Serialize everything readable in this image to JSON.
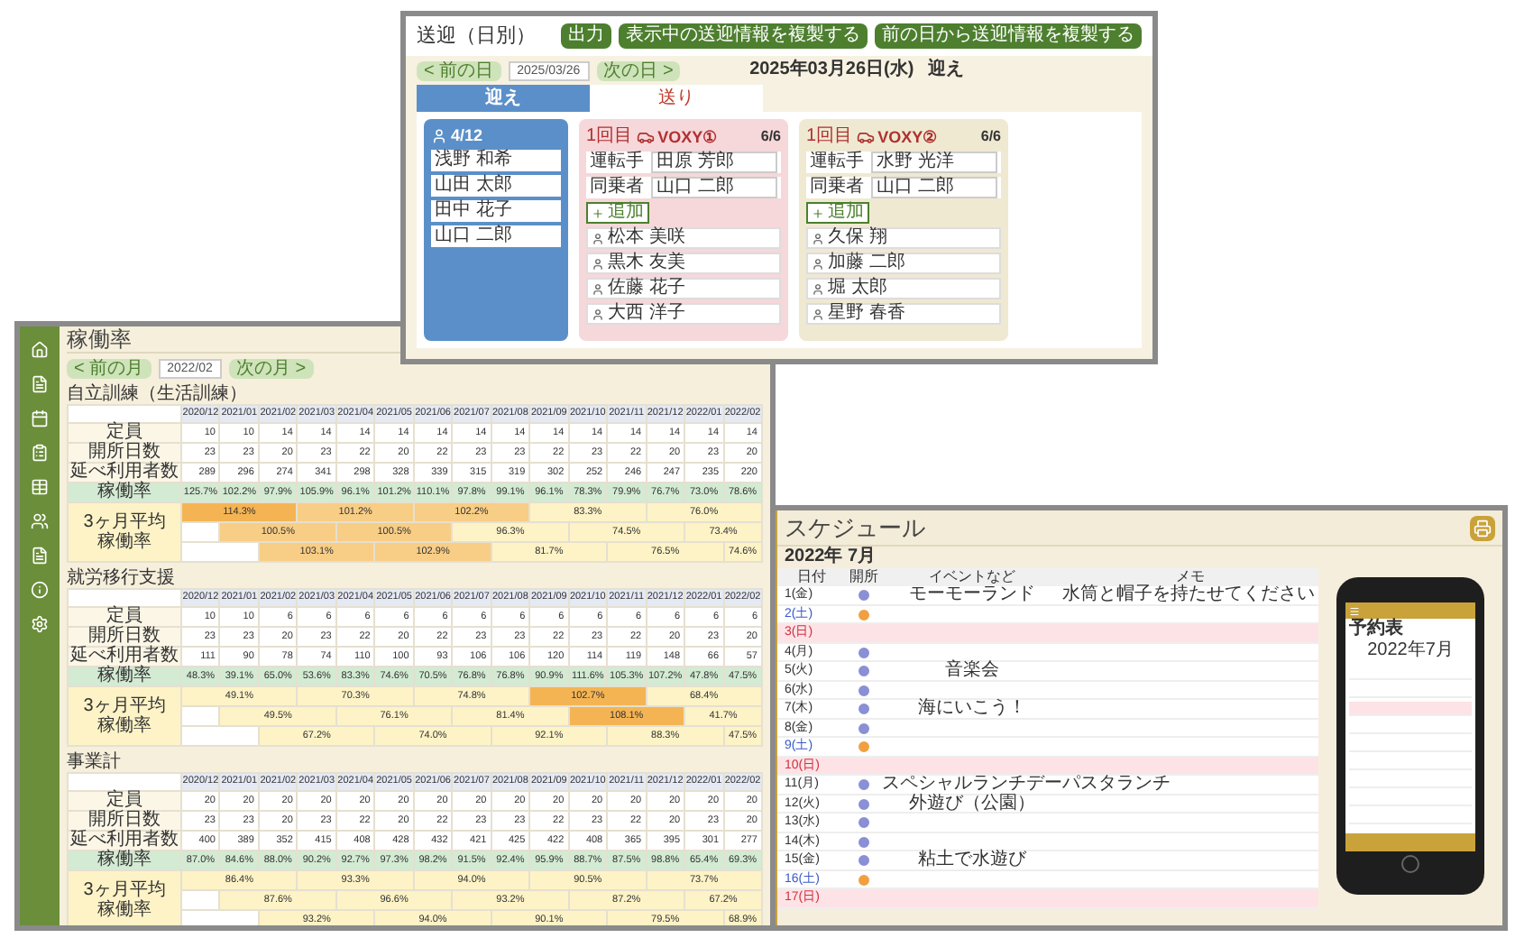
{
  "transport": {
    "title": "送迎（日別）",
    "buttons": [
      "出力",
      "表示中の送迎情報を複製する",
      "前の日から送迎情報を複製する"
    ],
    "date_nav": {
      "prev": "< 前の日",
      "date": "2025/03/26",
      "next": "次の日 >"
    },
    "heading_date": "2025年03月26日(水)",
    "heading_mode": "迎え",
    "tabs": [
      {
        "label": "迎え",
        "selected": true
      },
      {
        "label": "送り",
        "selected": false
      }
    ],
    "unassigned": {
      "count": "4/12",
      "items": [
        "浅野 和希",
        "山田 太郎",
        "田中 花子",
        "山口 二郎"
      ]
    },
    "vehicles": [
      {
        "trip": "1回目",
        "name": "VOXY①",
        "capacity": "6/6",
        "color": "#f6d7da",
        "driver_label": "運転手",
        "driver": "田原 芳郎",
        "co_label": "同乗者",
        "co": "山口 二郎",
        "add": "追加",
        "riders": [
          "松本 美咲",
          "黒木 友美",
          "佐藤 花子",
          "大西 洋子"
        ]
      },
      {
        "trip": "1回目",
        "name": "VOXY②",
        "capacity": "6/6",
        "color": "#efe9d2",
        "driver_label": "運転手",
        "driver": "水野 光洋",
        "co_label": "同乗者",
        "co": "山口 二郎",
        "add": "追加",
        "riders": [
          "久保 翔",
          "加藤 二郎",
          "堀 太郎",
          "星野 春香"
        ]
      }
    ]
  },
  "occupancy": {
    "title": "稼働率",
    "nav": {
      "prev": "< 前の月",
      "month": "2022/02",
      "next": "次の月 >"
    },
    "sections": [
      {
        "title": "自立訓練（生活訓練）",
        "months": [
          "2020/12",
          "2021/01",
          "2021/02",
          "2021/03",
          "2021/04",
          "2021/05",
          "2021/06",
          "2021/07",
          "2021/08",
          "2021/09",
          "2021/10",
          "2021/11",
          "2021/12",
          "2022/01",
          "2022/02"
        ],
        "rows": [
          {
            "label": "定員",
            "kind": "count",
            "values": [
              "10",
              "10",
              "14",
              "14",
              "14",
              "14",
              "14",
              "14",
              "14",
              "14",
              "14",
              "14",
              "14",
              "14",
              "14"
            ]
          },
          {
            "label": "開所日数",
            "kind": "count",
            "values": [
              "23",
              "23",
              "20",
              "23",
              "22",
              "20",
              "22",
              "23",
              "23",
              "22",
              "23",
              "22",
              "20",
              "23",
              "20"
            ]
          },
          {
            "label": "延べ利用者数",
            "kind": "count",
            "values": [
              "289",
              "296",
              "274",
              "341",
              "298",
              "328",
              "339",
              "315",
              "319",
              "302",
              "252",
              "246",
              "247",
              "235",
              "220"
            ]
          },
          {
            "label": "稼働率",
            "kind": "rate",
            "values": [
              "125.7%",
              "102.2%",
              "97.9%",
              "105.9%",
              "96.1%",
              "101.2%",
              "110.1%",
              "97.8%",
              "99.1%",
              "96.1%",
              "78.3%",
              "79.9%",
              "76.7%",
              "73.0%",
              "78.6%"
            ]
          }
        ],
        "average": {
          "label": "3ヶ月平均稼働率",
          "lines": [
            {
              "cells": [
                {
                  "text": "114.3%",
                  "color": "#f5b453"
                },
                {
                  "text": "101.2%",
                  "color": "#f8cd85"
                },
                {
                  "text": "102.2%",
                  "color": "#f8cd85"
                },
                {
                  "text": "83.3%",
                  "color": "#fdf3c6"
                },
                {
                  "text": "76.0%",
                  "color": "#fdf3c6"
                }
              ]
            },
            {
              "cells": [
                {
                  "text": "100.5%",
                  "color": "#f8cd85"
                },
                {
                  "text": "100.5%",
                  "color": "#f8cd85"
                },
                {
                  "text": "96.3%",
                  "color": "#fdf3c6"
                },
                {
                  "text": "74.5%",
                  "color": "#fdf3c6"
                },
                {
                  "text": "73.4%",
                  "color": "#fdf3c6"
                }
              ]
            },
            {
              "cells": [
                {
                  "text": "103.1%",
                  "color": "#f8cd85"
                },
                {
                  "text": "102.9%",
                  "color": "#f8cd85"
                },
                {
                  "text": "81.7%",
                  "color": "#fdf3c6"
                },
                {
                  "text": "76.5%",
                  "color": "#fdf3c6"
                },
                {
                  "text": "74.6%",
                  "color": "#fdf3c6"
                }
              ]
            }
          ]
        }
      },
      {
        "title": "就労移行支援",
        "months": [
          "2020/12",
          "2021/01",
          "2021/02",
          "2021/03",
          "2021/04",
          "2021/05",
          "2021/06",
          "2021/07",
          "2021/08",
          "2021/09",
          "2021/10",
          "2021/11",
          "2021/12",
          "2022/01",
          "2022/02"
        ],
        "rows": [
          {
            "label": "定員",
            "kind": "count",
            "values": [
              "10",
              "10",
              "6",
              "6",
              "6",
              "6",
              "6",
              "6",
              "6",
              "6",
              "6",
              "6",
              "6",
              "6",
              "6"
            ]
          },
          {
            "label": "開所日数",
            "kind": "count",
            "values": [
              "23",
              "23",
              "20",
              "23",
              "22",
              "20",
              "22",
              "23",
              "23",
              "22",
              "23",
              "22",
              "20",
              "23",
              "20"
            ]
          },
          {
            "label": "延べ利用者数",
            "kind": "count",
            "values": [
              "111",
              "90",
              "78",
              "74",
              "110",
              "100",
              "93",
              "106",
              "106",
              "120",
              "114",
              "119",
              "148",
              "66",
              "57"
            ]
          },
          {
            "label": "稼働率",
            "kind": "rate",
            "values": [
              "48.3%",
              "39.1%",
              "65.0%",
              "53.6%",
              "83.3%",
              "74.6%",
              "70.5%",
              "76.8%",
              "76.8%",
              "90.9%",
              "111.6%",
              "105.3%",
              "107.2%",
              "47.8%",
              "47.5%"
            ]
          }
        ],
        "average": {
          "label": "3ヶ月平均稼働率",
          "lines": [
            {
              "cells": [
                {
                  "text": "49.1%",
                  "color": "#fdf3c6"
                },
                {
                  "text": "70.3%",
                  "color": "#fdf3c6"
                },
                {
                  "text": "74.8%",
                  "color": "#fdf3c6"
                },
                {
                  "text": "102.7%",
                  "color": "#f5b453"
                },
                {
                  "text": "68.4%",
                  "color": "#fdf3c6"
                }
              ]
            },
            {
              "cells": [
                {
                  "text": "49.5%",
                  "color": "#fdf3c6"
                },
                {
                  "text": "76.1%",
                  "color": "#fdf3c6"
                },
                {
                  "text": "81.4%",
                  "color": "#fdf3c6"
                },
                {
                  "text": "108.1%",
                  "color": "#f5b453"
                },
                {
                  "text": "41.7%",
                  "color": "#fdf3c6"
                }
              ]
            },
            {
              "cells": [
                {
                  "text": "67.2%",
                  "color": "#fdf3c6"
                },
                {
                  "text": "74.0%",
                  "color": "#fdf3c6"
                },
                {
                  "text": "92.1%",
                  "color": "#fdf3c6"
                },
                {
                  "text": "88.3%",
                  "color": "#fdf3c6"
                },
                {
                  "text": "47.5%",
                  "color": "#fdf3c6"
                }
              ]
            }
          ]
        }
      },
      {
        "title": "事業計",
        "months": [
          "2020/12",
          "2021/01",
          "2021/02",
          "2021/03",
          "2021/04",
          "2021/05",
          "2021/06",
          "2021/07",
          "2021/08",
          "2021/09",
          "2021/10",
          "2021/11",
          "2021/12",
          "2022/01",
          "2022/02"
        ],
        "rows": [
          {
            "label": "定員",
            "kind": "count",
            "values": [
              "20",
              "20",
              "20",
              "20",
              "20",
              "20",
              "20",
              "20",
              "20",
              "20",
              "20",
              "20",
              "20",
              "20",
              "20"
            ]
          },
          {
            "label": "開所日数",
            "kind": "count",
            "values": [
              "23",
              "23",
              "20",
              "23",
              "22",
              "20",
              "22",
              "23",
              "23",
              "22",
              "23",
              "22",
              "20",
              "23",
              "20"
            ]
          },
          {
            "label": "延べ利用者数",
            "kind": "count",
            "values": [
              "400",
              "389",
              "352",
              "415",
              "408",
              "428",
              "432",
              "421",
              "425",
              "422",
              "408",
              "365",
              "395",
              "301",
              "277"
            ]
          },
          {
            "label": "稼働率",
            "kind": "rate",
            "values": [
              "87.0%",
              "84.6%",
              "88.0%",
              "90.2%",
              "92.7%",
              "97.3%",
              "98.2%",
              "91.5%",
              "92.4%",
              "95.9%",
              "88.7%",
              "87.5%",
              "98.8%",
              "65.4%",
              "69.3%"
            ]
          }
        ],
        "average": {
          "label": "3ヶ月平均稼働率",
          "lines": [
            {
              "cells": [
                {
                  "text": "86.4%",
                  "color": "#fdf3c6"
                },
                {
                  "text": "93.3%",
                  "color": "#fdf3c6"
                },
                {
                  "text": "94.0%",
                  "color": "#fdf3c6"
                },
                {
                  "text": "90.5%",
                  "color": "#fdf3c6"
                },
                {
                  "text": "73.7%",
                  "color": "#fdf3c6"
                }
              ]
            },
            {
              "cells": [
                {
                  "text": "87.6%",
                  "color": "#fdf3c6"
                },
                {
                  "text": "96.6%",
                  "color": "#fdf3c6"
                },
                {
                  "text": "93.2%",
                  "color": "#fdf3c6"
                },
                {
                  "text": "87.2%",
                  "color": "#fdf3c6"
                },
                {
                  "text": "67.2%",
                  "color": "#fdf3c6"
                }
              ]
            },
            {
              "cells": [
                {
                  "text": "93.2%",
                  "color": "#fdf3c6"
                },
                {
                  "text": "94.0%",
                  "color": "#fdf3c6"
                },
                {
                  "text": "90.1%",
                  "color": "#fdf3c6"
                },
                {
                  "text": "79.5%",
                  "color": "#fdf3c6"
                },
                {
                  "text": "68.9%",
                  "color": "#fdf3c6"
                }
              ]
            }
          ]
        }
      }
    ]
  },
  "schedule": {
    "title": "スケジュール",
    "month": "2022年 7月",
    "columns": [
      "日付",
      "開所",
      "イベントなど",
      "メモ"
    ],
    "rows": [
      {
        "day": "1(金)",
        "kind": "weekday",
        "event": "モーモーランド",
        "memo": "水筒と帽子を持たせてください"
      },
      {
        "day": "2(土)",
        "kind": "saturday"
      },
      {
        "day": "3(日)",
        "kind": "sunday"
      },
      {
        "day": "4(月)",
        "kind": "weekday"
      },
      {
        "day": "5(火)",
        "kind": "weekday",
        "event": "音楽会"
      },
      {
        "day": "6(水)",
        "kind": "weekday"
      },
      {
        "day": "7(木)",
        "kind": "weekday",
        "event": "海にいこう！"
      },
      {
        "day": "8(金)",
        "kind": "weekday"
      },
      {
        "day": "9(土)",
        "kind": "saturday"
      },
      {
        "day": "10(日)",
        "kind": "sunday"
      },
      {
        "day": "11(月)",
        "kind": "weekday",
        "event": "スペシャルランチデー",
        "memo": "パスタランチ"
      },
      {
        "day": "12(火)",
        "kind": "weekday",
        "event": "外遊び（公園）"
      },
      {
        "day": "13(水)",
        "kind": "weekday"
      },
      {
        "day": "14(木)",
        "kind": "weekday"
      },
      {
        "day": "15(金)",
        "kind": "weekday",
        "event": "粘土で水遊び"
      },
      {
        "day": "16(土)",
        "kind": "saturday"
      },
      {
        "day": "17(日)",
        "kind": "sunday"
      }
    ],
    "phone": {
      "title": "予約表",
      "month": "2022年7月"
    }
  }
}
